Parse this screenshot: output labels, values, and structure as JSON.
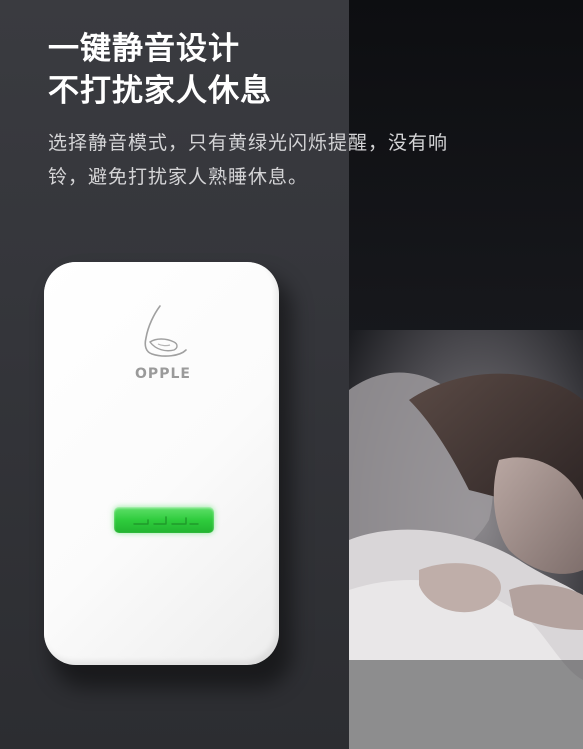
{
  "headline": {
    "line1": "一键静音设计",
    "line2": "不打扰家人休息"
  },
  "description": {
    "line1": "选择静音模式，只有黄绿光闪烁提醒，没有响",
    "line2": "铃，避免打扰家人熟睡休息。"
  },
  "device": {
    "brand": "OPPLE",
    "led_color": "#2fcc3d"
  },
  "icons": {
    "brand_logo": "opple-logo-icon",
    "indicator": "green-led-indicator"
  }
}
